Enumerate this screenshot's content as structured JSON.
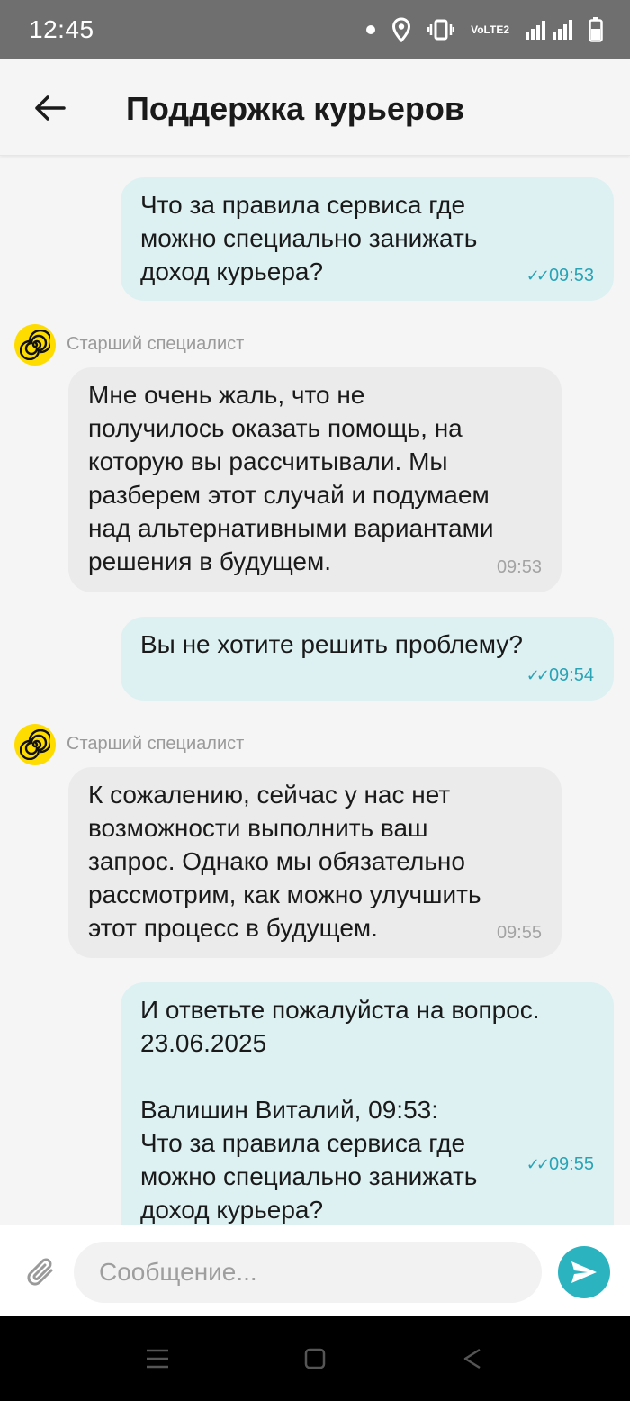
{
  "status_bar": {
    "time": "12:45",
    "volte_line1": "Vo",
    "volte_line2": "LTE2",
    "icons": [
      "dot-icon",
      "location-icon",
      "vibrate-icon",
      "volte-icon",
      "signal-icon",
      "battery-icon"
    ]
  },
  "header": {
    "title": "Поддержка курьеров",
    "back_icon": "arrow-left-icon"
  },
  "chat": {
    "messages": [
      {
        "direction": "outgoing",
        "text": "Что за правила сервиса где\nможно специально занижать\nдоход курьера?",
        "time": "09:53",
        "read": true
      },
      {
        "direction": "incoming",
        "sender": "Старший специалист",
        "text": "Мне очень жаль, что не\nполучилось оказать помощь, на\nкоторую вы рассчитывали. Мы\nразберем этот случай и подумаем\nнад альтернативными вариантами\nрешения в будущем.",
        "time": "09:53"
      },
      {
        "direction": "outgoing",
        "text": "Вы не хотите решить проблему?",
        "time": "09:54",
        "read": true
      },
      {
        "direction": "incoming",
        "sender": "Старший специалист",
        "text": "К сожалению, сейчас у нас нет\nвозможности выполнить ваш\nзапрос. Однако мы обязательно\nрассмотрим, как можно улучшить\nэтот процесс в будущем.",
        "time": "09:55"
      },
      {
        "direction": "outgoing",
        "text": "И ответьте пожалуйста на вопрос.\n23.06.2025\n\nВалишин  Виталий, 09:53:\nЧто за правила сервиса где\nможно специально занижать\nдоход курьера?",
        "time": "09:55",
        "read": true
      }
    ]
  },
  "composer": {
    "placeholder": "Сообщение...",
    "attach_icon": "paperclip-icon",
    "send_icon": "send-icon"
  },
  "colors": {
    "outgoing_bubble": "#ddf1f3",
    "incoming_bubble": "#ebebeb",
    "accent": "#2bb3c0",
    "avatar": "#ffdc00"
  }
}
